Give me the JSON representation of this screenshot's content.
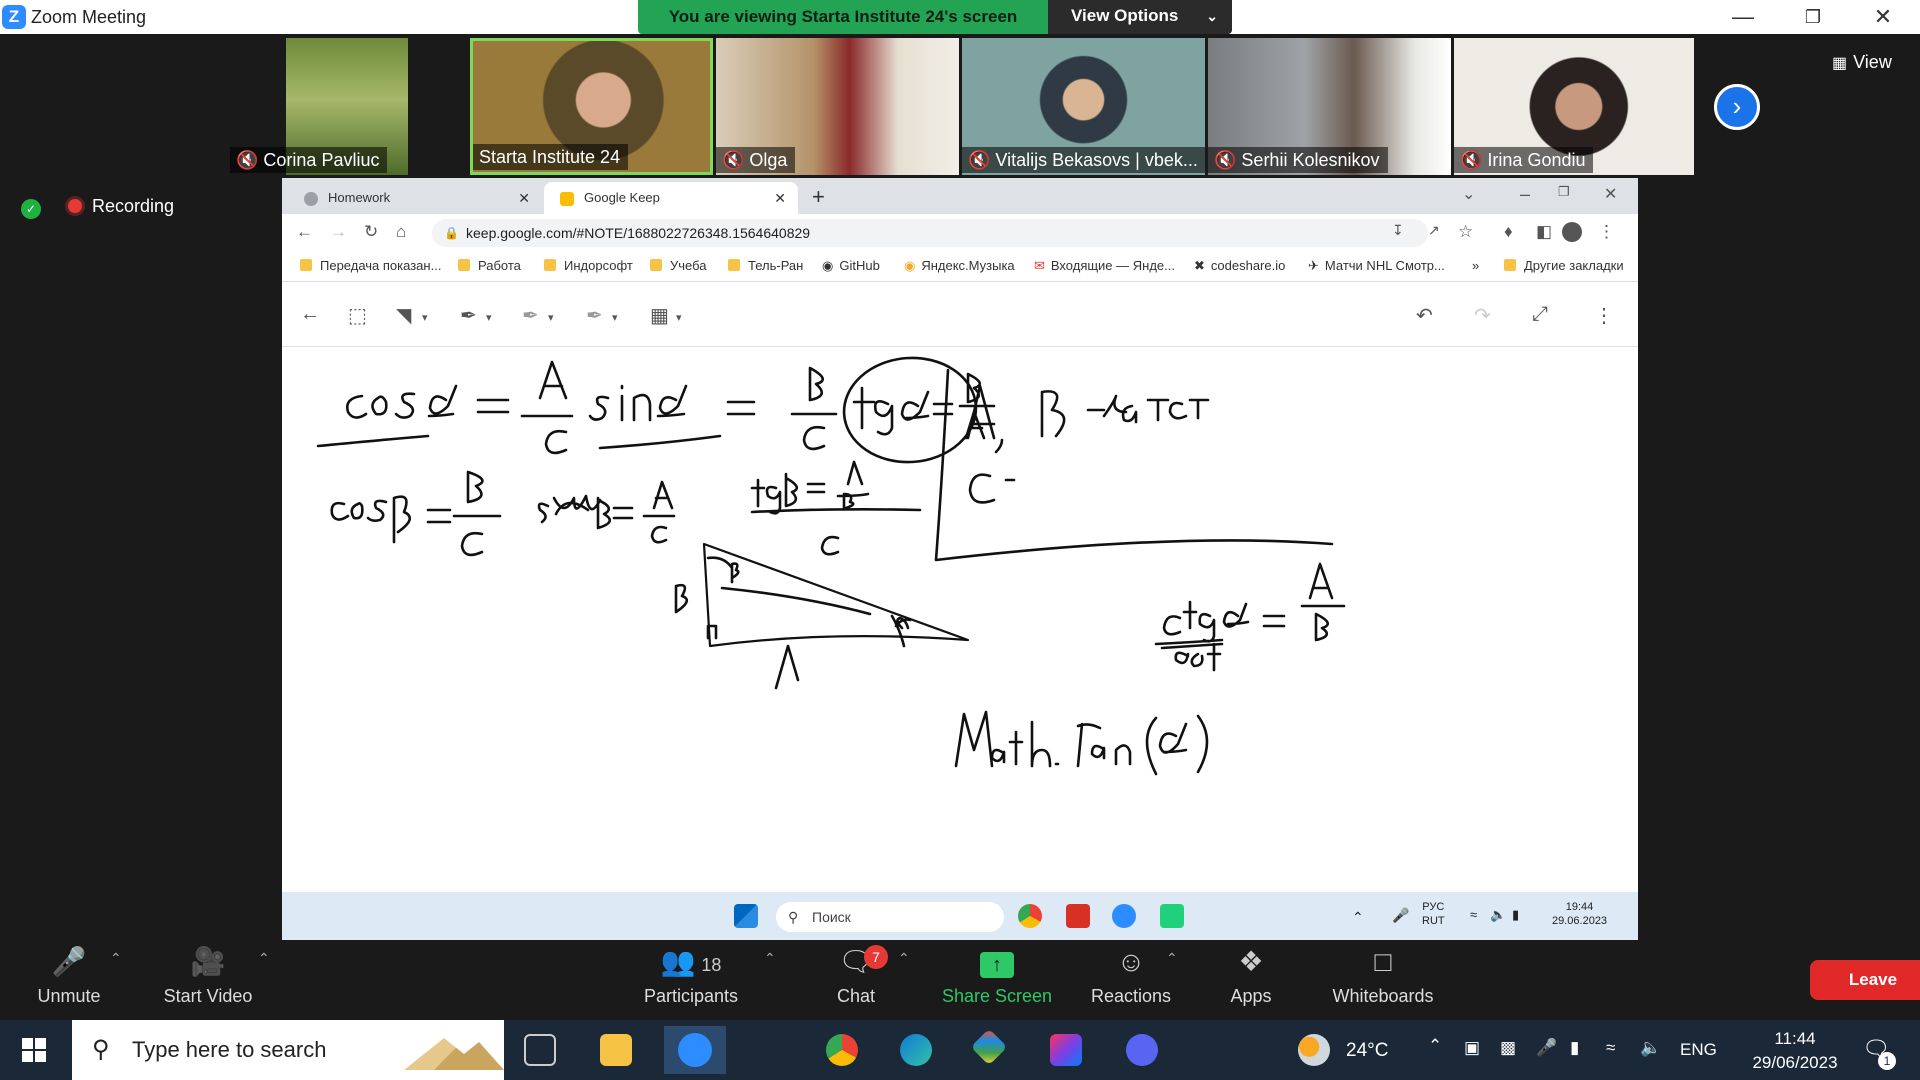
{
  "zoom": {
    "window_title": "Zoom Meeting",
    "share_banner": "You are viewing Starta Institute 24's screen",
    "view_options": "View Options",
    "view_button": "View",
    "recording": "Recording",
    "participants": [
      {
        "name": "Corina Pavliuc",
        "muted": true
      },
      {
        "name": "Starta Institute 24",
        "muted": false
      },
      {
        "name": "Olga",
        "muted": true
      },
      {
        "name": "Vitalijs Bekasovs | vbek...",
        "muted": true
      },
      {
        "name": "Serhii Kolesnikov",
        "muted": true
      },
      {
        "name": "Irina Gondiu",
        "muted": true
      }
    ],
    "controls": {
      "unmute": "Unmute",
      "start_video": "Start Video",
      "participants": "Participants",
      "participants_count": "18",
      "chat": "Chat",
      "chat_badge": "7",
      "share_screen": "Share Screen",
      "reactions": "Reactions",
      "apps": "Apps",
      "whiteboards": "Whiteboards",
      "leave": "Leave"
    }
  },
  "browser": {
    "tabs": [
      {
        "label": "Homework",
        "active": false
      },
      {
        "label": "Google Keep",
        "active": true
      }
    ],
    "url": "keep.google.com/#NOTE/1688022726348.1564640829",
    "bookmarks": [
      "Передача показан...",
      "Работа",
      "Индорсофт",
      "Учеба",
      "Тель-Ран",
      "GitHub",
      "Яндекс.Музыка",
      "Входящие — Яндe...",
      "codeshare.io",
      "Матчи NHL Смотр..."
    ],
    "bookmarks_more": "»",
    "other_bookmarks": "Другие закладки"
  },
  "remote_taskbar": {
    "search_placeholder": "Поиск",
    "lang_line1": "РУС",
    "lang_line2": "RUT",
    "time": "19:44",
    "date": "29.06.2023"
  },
  "windows_taskbar": {
    "search_placeholder": "Type here to search",
    "weather": "24°C",
    "lang": "ENG",
    "time": "11:44",
    "date": "29/06/2023",
    "notification_count": "1"
  },
  "colors": {
    "zoom_blue": "#2d8cff",
    "banner_green": "#23a455",
    "leave_red": "#e02828",
    "share_green": "#2ec866"
  }
}
